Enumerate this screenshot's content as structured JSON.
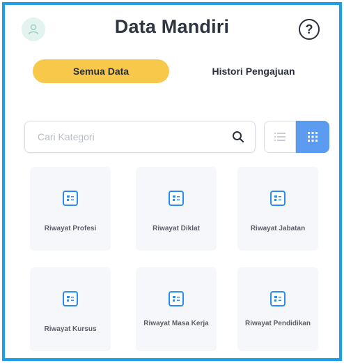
{
  "header": {
    "title": "Data Mandiri",
    "help_label": "?"
  },
  "tabs": [
    {
      "label": "Semua Data",
      "active": true
    },
    {
      "label": "Histori Pengajuan",
      "active": false
    }
  ],
  "search": {
    "placeholder": "Cari Kategori",
    "value": ""
  },
  "view_toggle": {
    "selected": "grid"
  },
  "categories": [
    {
      "label": "Riwayat Profesi",
      "icon": "document-icon"
    },
    {
      "label": "Riwayat Diklat",
      "icon": "document-icon"
    },
    {
      "label": "Riwayat Jabatan",
      "icon": "document-icon"
    },
    {
      "label": "Riwayat Kursus",
      "icon": "document-icon"
    },
    {
      "label": "Riwayat Masa Kerja",
      "icon": "document-icon"
    },
    {
      "label": "Riwayat Pendidikan",
      "icon": "document-icon"
    }
  ],
  "colors": {
    "frame": "#1aa0e6",
    "tab_active": "#f7c84a",
    "grid_button": "#5b9bf0",
    "icon_accent": "#2a8cf0"
  }
}
